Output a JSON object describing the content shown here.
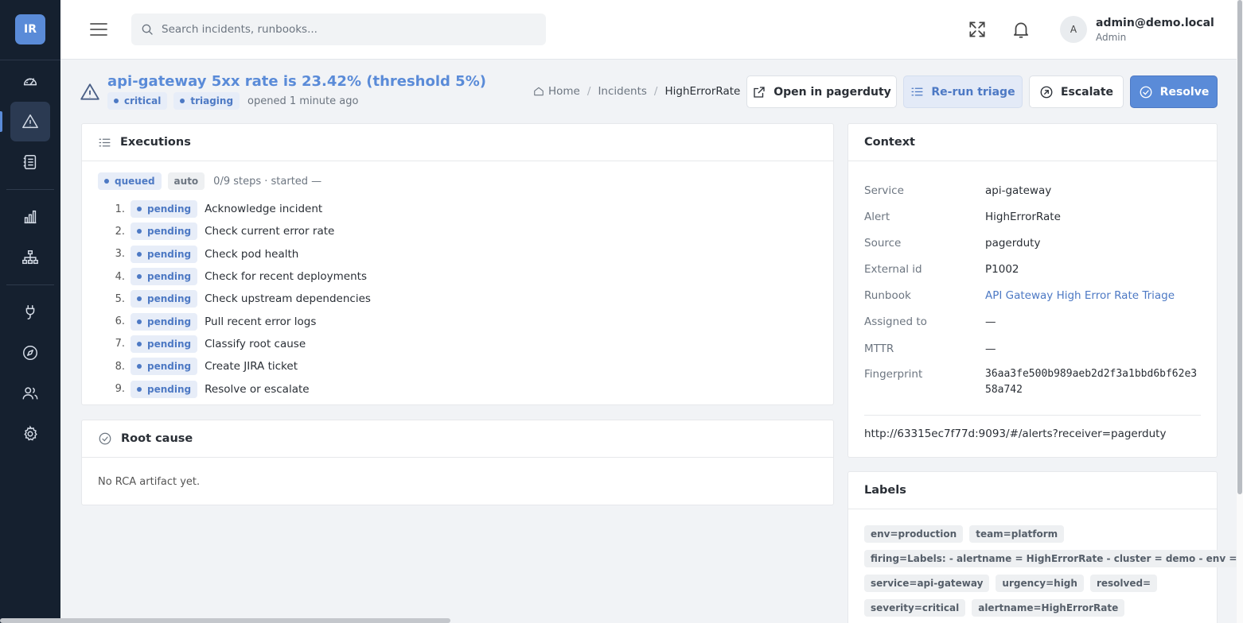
{
  "sidebar": {
    "logo": "IR",
    "items": [
      {
        "name": "dashboard",
        "icon": "gauge-icon"
      },
      {
        "name": "incidents",
        "icon": "alert-triangle-icon",
        "active": true
      },
      {
        "name": "runbooks",
        "icon": "notebook-icon"
      },
      {
        "name": "analytics",
        "icon": "bar-chart-icon"
      },
      {
        "name": "topology",
        "icon": "sitemap-icon"
      },
      {
        "name": "integrations",
        "icon": "plug-icon"
      },
      {
        "name": "explore",
        "icon": "compass-icon"
      },
      {
        "name": "teams",
        "icon": "users-icon"
      },
      {
        "name": "settings",
        "icon": "gear-icon"
      }
    ]
  },
  "topbar": {
    "search_placeholder": "Search incidents, runbooks...",
    "avatar_initial": "A",
    "user_name": "admin@demo.local",
    "user_role": "Admin"
  },
  "incident": {
    "title": "api-gateway 5xx rate is 23.42% (threshold 5%)",
    "severity": "critical",
    "status": "triaging",
    "opened": "opened 1 minute ago"
  },
  "breadcrumb": {
    "home": "Home",
    "incidents": "Incidents",
    "current": "HighErrorRate"
  },
  "actions": {
    "open_external": "Open in pagerduty",
    "rerun": "Re-run triage",
    "escalate": "Escalate",
    "resolve": "Resolve"
  },
  "executions": {
    "title": "Executions",
    "state": "queued",
    "mode": "auto",
    "summary": "0/9 steps · started —",
    "steps": [
      {
        "num": "1.",
        "status": "pending",
        "label": "Acknowledge incident"
      },
      {
        "num": "2.",
        "status": "pending",
        "label": "Check current error rate"
      },
      {
        "num": "3.",
        "status": "pending",
        "label": "Check pod health"
      },
      {
        "num": "4.",
        "status": "pending",
        "label": "Check for recent deployments"
      },
      {
        "num": "5.",
        "status": "pending",
        "label": "Check upstream dependencies"
      },
      {
        "num": "6.",
        "status": "pending",
        "label": "Pull recent error logs"
      },
      {
        "num": "7.",
        "status": "pending",
        "label": "Classify root cause"
      },
      {
        "num": "8.",
        "status": "pending",
        "label": "Create JIRA ticket"
      },
      {
        "num": "9.",
        "status": "pending",
        "label": "Resolve or escalate"
      }
    ]
  },
  "root_cause": {
    "title": "Root cause",
    "empty": "No RCA artifact yet."
  },
  "context": {
    "title": "Context",
    "rows": [
      {
        "key": "Service",
        "value": "api-gateway"
      },
      {
        "key": "Alert",
        "value": "HighErrorRate"
      },
      {
        "key": "Source",
        "value": "pagerduty"
      },
      {
        "key": "External id",
        "value": "P1002"
      },
      {
        "key": "Runbook",
        "value": "API Gateway High Error Rate Triage"
      },
      {
        "key": "Assigned to",
        "value": "—"
      },
      {
        "key": "MTTR",
        "value": "—"
      },
      {
        "key": "Fingerprint",
        "value": "36aa3fe500b989aeb2d2f3a1bbd6bf62e358a742"
      }
    ],
    "url": "http://63315ec7f77d:9093/#/alerts?receiver=pagerduty"
  },
  "labels": {
    "title": "Labels",
    "items": [
      "env=production",
      "team=platform",
      "firing=Labels: - alertname = HighErrorRate - cluster = demo - env = production",
      "service=api-gateway",
      "urgency=high",
      "resolved=",
      "severity=critical",
      "alertname=HighErrorRate"
    ]
  },
  "colors": {
    "accent": "#5a8bd8",
    "sidebar_bg": "#15202f"
  }
}
